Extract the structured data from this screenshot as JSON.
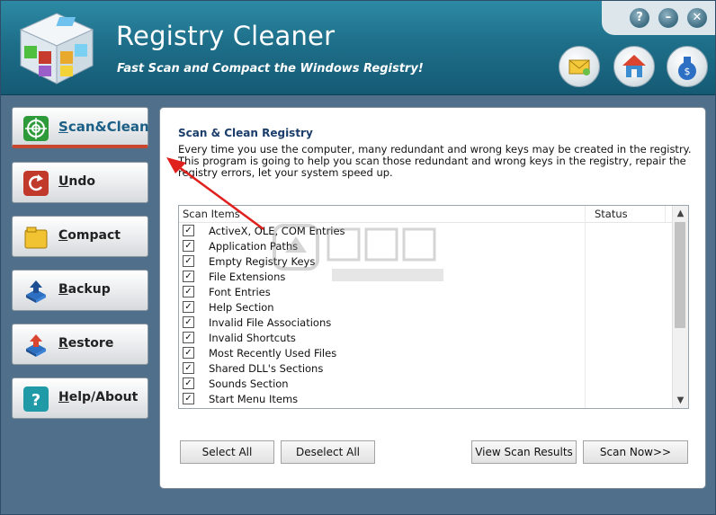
{
  "app": {
    "title": "Registry Cleaner",
    "subtitle": "Fast Scan and Compact the Windows Registry!"
  },
  "window_controls": [
    {
      "name": "help-icon",
      "glyph": "?"
    },
    {
      "name": "minimize-icon",
      "glyph": "–"
    },
    {
      "name": "close-icon",
      "glyph": "✕"
    }
  ],
  "toolbar": [
    {
      "name": "email-icon"
    },
    {
      "name": "home-icon"
    },
    {
      "name": "money-bag-icon"
    }
  ],
  "nav": [
    {
      "label": "Scan&Clean",
      "icon": "target-icon",
      "active": true
    },
    {
      "label": "Undo",
      "icon": "undo-arrow-icon",
      "active": false
    },
    {
      "label": "Compact",
      "icon": "folder-icon",
      "active": false
    },
    {
      "label": "Backup",
      "icon": "backup-tray-icon",
      "active": false
    },
    {
      "label": "Restore",
      "icon": "restore-tray-icon",
      "active": false
    },
    {
      "label": "Help/About",
      "icon": "question-icon",
      "active": false
    }
  ],
  "panel": {
    "title": "Scan & Clean Registry",
    "description": "Every time you use the computer, many redundant and wrong keys may be created in the registry. This program is going to help you scan those redundant and wrong keys in the registry, repair the registry errors, let your system speed up."
  },
  "list": {
    "columns": [
      "Scan Items",
      "Status"
    ],
    "items": [
      {
        "label": "ActiveX, OLE, COM Entries",
        "checked": true
      },
      {
        "label": "Application Paths",
        "checked": true
      },
      {
        "label": "Empty Registry Keys",
        "checked": true
      },
      {
        "label": "File Extensions",
        "checked": true
      },
      {
        "label": "Font Entries",
        "checked": true
      },
      {
        "label": "Help Section",
        "checked": true
      },
      {
        "label": "Invalid File Associations",
        "checked": true
      },
      {
        "label": "Invalid Shortcuts",
        "checked": true
      },
      {
        "label": "Most Recently Used Files",
        "checked": true
      },
      {
        "label": "Shared DLL's Sections",
        "checked": true
      },
      {
        "label": "Sounds Section",
        "checked": true
      },
      {
        "label": "Start Menu Items",
        "checked": true
      }
    ]
  },
  "buttons": {
    "select_all": "Select All",
    "deselect_all": "Deselect All",
    "view_results": "View Scan Results",
    "scan_now": "Scan Now>>"
  },
  "colors": {
    "header": "#1e6f8a",
    "background": "#4f6f8b",
    "active_accent": "#c8472e",
    "title_text": "#1a3d6b"
  }
}
